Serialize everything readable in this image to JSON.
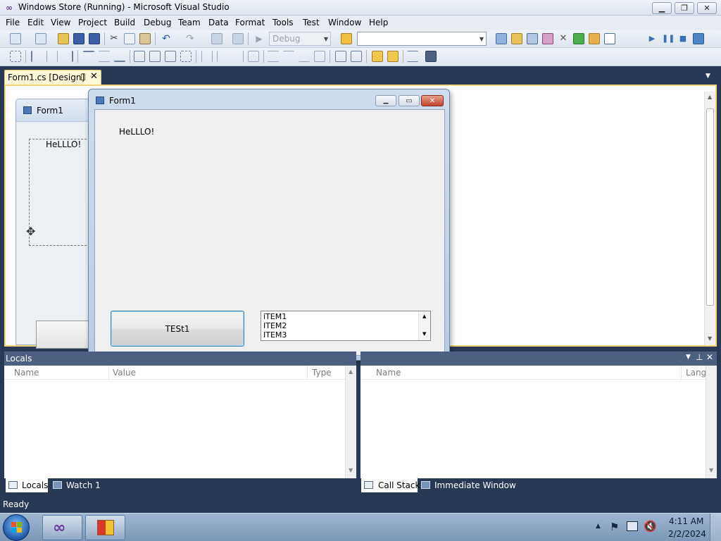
{
  "window": {
    "title": "Windows Store (Running) - Microsoft Visual Studio",
    "logo_icon": "visual-studio-infinity-icon",
    "minimize_icon": "minimize-icon",
    "maximize_icon": "restore-icon",
    "close_icon": "close-icon"
  },
  "menu": [
    "File",
    "Edit",
    "View",
    "Project",
    "Build",
    "Debug",
    "Team",
    "Data",
    "Format",
    "Tools",
    "Test",
    "Window",
    "Help"
  ],
  "toolbar": {
    "config_combo": "Debug",
    "platform_combo": ""
  },
  "document_tab": {
    "label": "Form1.cs [Design]",
    "pin_icon": "pin-icon",
    "close_icon": "close-icon"
  },
  "design_form": {
    "title": "Form1",
    "label_text": "HeLLLO!",
    "move_icon": "move-cursor-icon"
  },
  "running_form": {
    "title": "Form1",
    "label_text": "HeLLLO!",
    "button_text": "TESt1",
    "list_items": [
      "iTEM1",
      "ITEM2",
      "ITEM3"
    ]
  },
  "locals_panel": {
    "title": "Locals",
    "columns": [
      "Name",
      "Value",
      "Type"
    ],
    "tabs": [
      "Locals",
      "Watch 1"
    ],
    "active_tab": "Locals"
  },
  "callstack_panel": {
    "columns": [
      "Name",
      "Lang"
    ],
    "tabs": [
      "Call Stack",
      "Immediate Window"
    ],
    "active_tab": "Call Stack"
  },
  "status": {
    "text": "Ready"
  },
  "taskbar": {
    "time": "4:11 AM",
    "date": "2/2/2024",
    "start_icon": "windows-start-icon",
    "apps": [
      "visual-studio-icon",
      "windows-form-app-icon"
    ],
    "tray_icons": [
      "show-hidden-icons-icon",
      "action-center-flag-icon",
      "network-icon",
      "speaker-muted-icon"
    ]
  },
  "colors": {
    "chrome_dark": "#293955",
    "panel_header": "#4d6082",
    "doc_tab": "#fff8d6",
    "button_border": "#3c7fb1"
  }
}
